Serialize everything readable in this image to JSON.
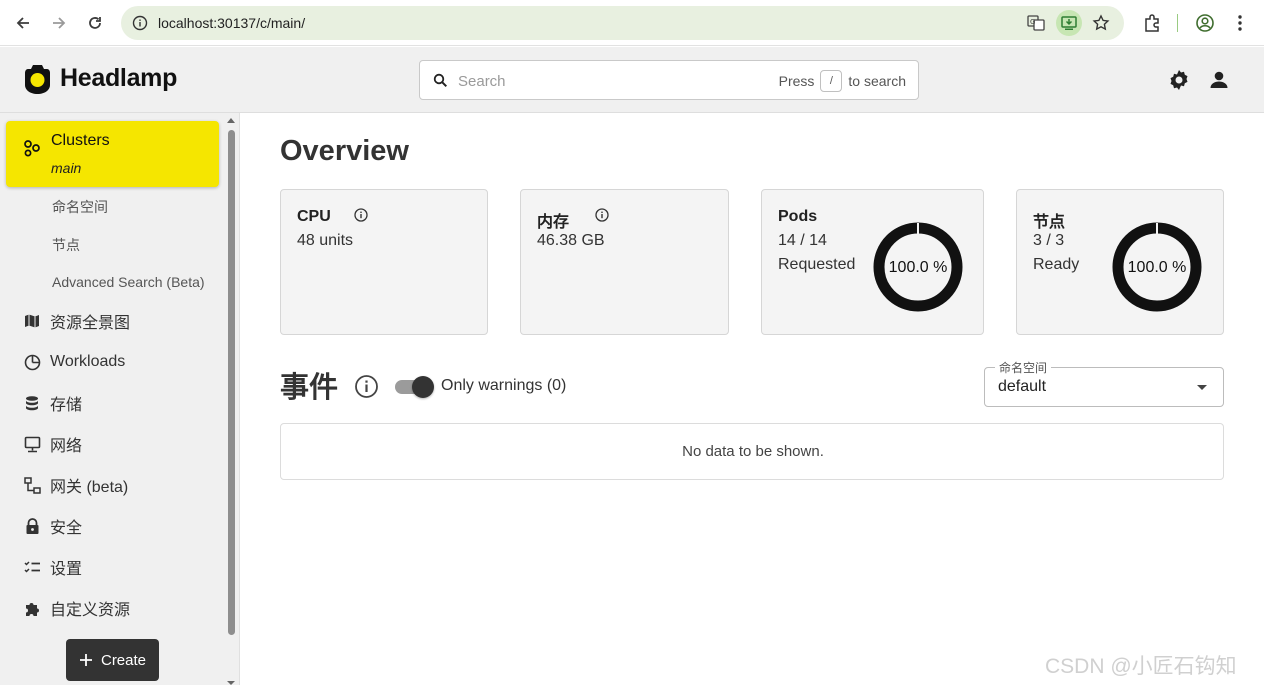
{
  "browser": {
    "url": "localhost:30137/c/main/"
  },
  "header": {
    "logo_text": "Headlamp",
    "search": {
      "placeholder": "Search",
      "hint_prefix": "Press",
      "hint_key": "/",
      "hint_suffix": "to search"
    }
  },
  "sidebar": {
    "active": {
      "label": "Clusters",
      "sublabel": "main"
    },
    "subitems": [
      "命名空间",
      "节点",
      "Advanced Search (Beta)"
    ],
    "items": [
      {
        "label": "资源全景图",
        "icon": "map-icon"
      },
      {
        "label": "Workloads",
        "icon": "pie-icon"
      },
      {
        "label": "存储",
        "icon": "database-icon"
      },
      {
        "label": "网络",
        "icon": "network-icon"
      },
      {
        "label": "网关 (beta)",
        "icon": "gateway-icon"
      },
      {
        "label": "安全",
        "icon": "lock-icon"
      },
      {
        "label": "设置",
        "icon": "checklist-icon"
      },
      {
        "label": "自定义资源",
        "icon": "puzzle-icon"
      }
    ],
    "create_label": "Create"
  },
  "main": {
    "title": "Overview",
    "cards": {
      "cpu": {
        "title": "CPU",
        "value": "48 units"
      },
      "memory": {
        "title": "内存",
        "value": "46.38 GB"
      },
      "pods": {
        "title": "Pods",
        "value": "14 / 14",
        "status": "Requested",
        "percent_label": "100.0 %",
        "percent": 100
      },
      "nodes": {
        "title": "节点",
        "value": "3 / 3",
        "status": "Ready",
        "percent_label": "100.0 %",
        "percent": 100
      }
    },
    "events": {
      "title": "事件",
      "toggle_label": "Only warnings (0)",
      "toggle_on": true,
      "namespace_label": "命名空间",
      "namespace_value": "default",
      "empty_text": "No data to be shown."
    }
  },
  "watermark": "CSDN @小匠石钩知",
  "colors": {
    "accent": "#f5e600",
    "sidebar_bg": "#f0f0f0",
    "donut": "#111111"
  }
}
